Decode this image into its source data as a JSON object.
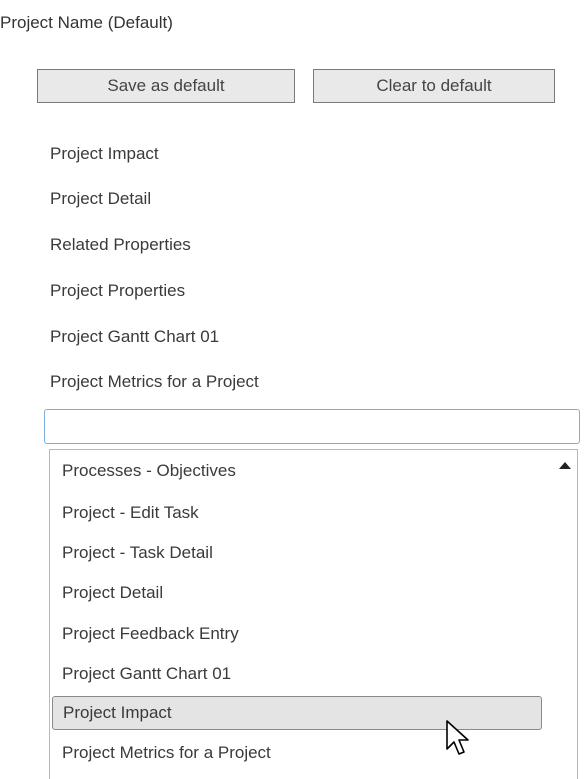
{
  "title": "Project Name (Default)",
  "buttons": {
    "save_label": "Save as default",
    "clear_label": "Clear to default"
  },
  "items": [
    "Project Impact",
    "Project Detail",
    "Related Properties",
    "Project Properties",
    "Project Gantt Chart 01",
    "Project Metrics for a Project"
  ],
  "search": {
    "value": ""
  },
  "dropdown": {
    "options": [
      "Processes - Objectives",
      "Project - Edit Task",
      "Project - Task Detail",
      "Project Detail",
      "Project Feedback Entry",
      "Project Gantt Chart 01",
      "Project Impact",
      "Project Metrics for a Project"
    ],
    "selected": "Project Impact"
  },
  "icons": {
    "scroll": "scroll-up-arrow-icon",
    "cursor": "mouse-pointer-icon"
  }
}
